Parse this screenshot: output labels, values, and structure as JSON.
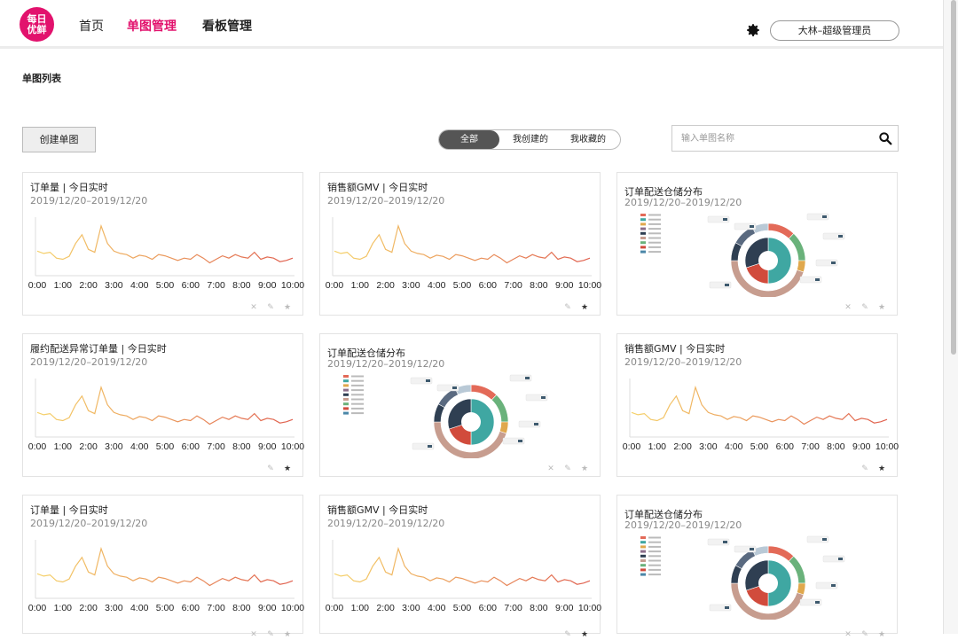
{
  "logo": {
    "line1": "每日",
    "line2": "优鲜"
  },
  "nav": {
    "home": "首页",
    "charts": "单图管理",
    "boards": "看板管理"
  },
  "user": {
    "name": "大林–超级管理员"
  },
  "page": {
    "title": "单图列表"
  },
  "toolbar": {
    "create_label": "创建单图"
  },
  "filters": {
    "all": "全部",
    "mine": "我创建的",
    "fav": "我收藏的"
  },
  "search": {
    "placeholder": "输入单图名称"
  },
  "time_labels": [
    "0:00",
    "1:00",
    "2:00",
    "3:00",
    "4:00",
    "5:00",
    "6:00",
    "7:00",
    "8:00",
    "9:00",
    "10:00"
  ],
  "legend_items": [
    "A",
    "B",
    "C",
    "D",
    "E",
    "F",
    "G",
    "H",
    "I"
  ],
  "line_series": [
    42,
    38,
    40,
    30,
    28,
    33,
    55,
    70,
    45,
    40,
    85,
    55,
    42,
    38,
    36,
    30,
    35,
    33,
    28,
    36,
    34,
    30,
    26,
    30,
    28,
    36,
    30,
    22,
    28,
    34,
    30,
    36,
    32,
    30,
    40,
    28,
    32,
    30,
    24,
    26,
    30
  ],
  "colors": {
    "brand": "#e2126d",
    "donut": [
      "#e36a58",
      "#3fa7a2",
      "#e0a84d",
      "#8c6e8a",
      "#2f3f52",
      "#c79d8f",
      "#6ab27b",
      "#d14b3c",
      "#4b87a8"
    ]
  },
  "cards": [
    {
      "title": "订单量 | 今日实时",
      "date": "2019/12/20–2019/12/20",
      "type": "line",
      "star": false
    },
    {
      "title": "销售额GMV | 今日实时",
      "date": "2019/12/20–2019/12/20",
      "type": "line",
      "star": true
    },
    {
      "title": "订单配送仓储分布",
      "date": "2019/12/20–2019/12/20",
      "type": "donut",
      "star": false
    },
    {
      "title": "履约配送异常订单量 | 今日实时",
      "date": "2019/12/20–2019/12/20",
      "type": "line",
      "star": true
    },
    {
      "title": "订单配送仓储分布",
      "date": "2019/12/20–2019/12/20",
      "type": "donut",
      "star": false
    },
    {
      "title": "销售额GMV | 今日实时",
      "date": "2019/12/20–2019/12/20",
      "type": "line",
      "star": true
    },
    {
      "title": "订单量 | 今日实时",
      "date": "2019/12/20–2019/12/20",
      "type": "line",
      "star": false
    },
    {
      "title": "销售额GMV | 今日实时",
      "date": "2019/12/20–2019/12/20",
      "type": "line",
      "star": true
    },
    {
      "title": "订单配送仓储分布",
      "date": "2019/12/20–2019/12/20",
      "type": "donut",
      "star": false
    }
  ]
}
